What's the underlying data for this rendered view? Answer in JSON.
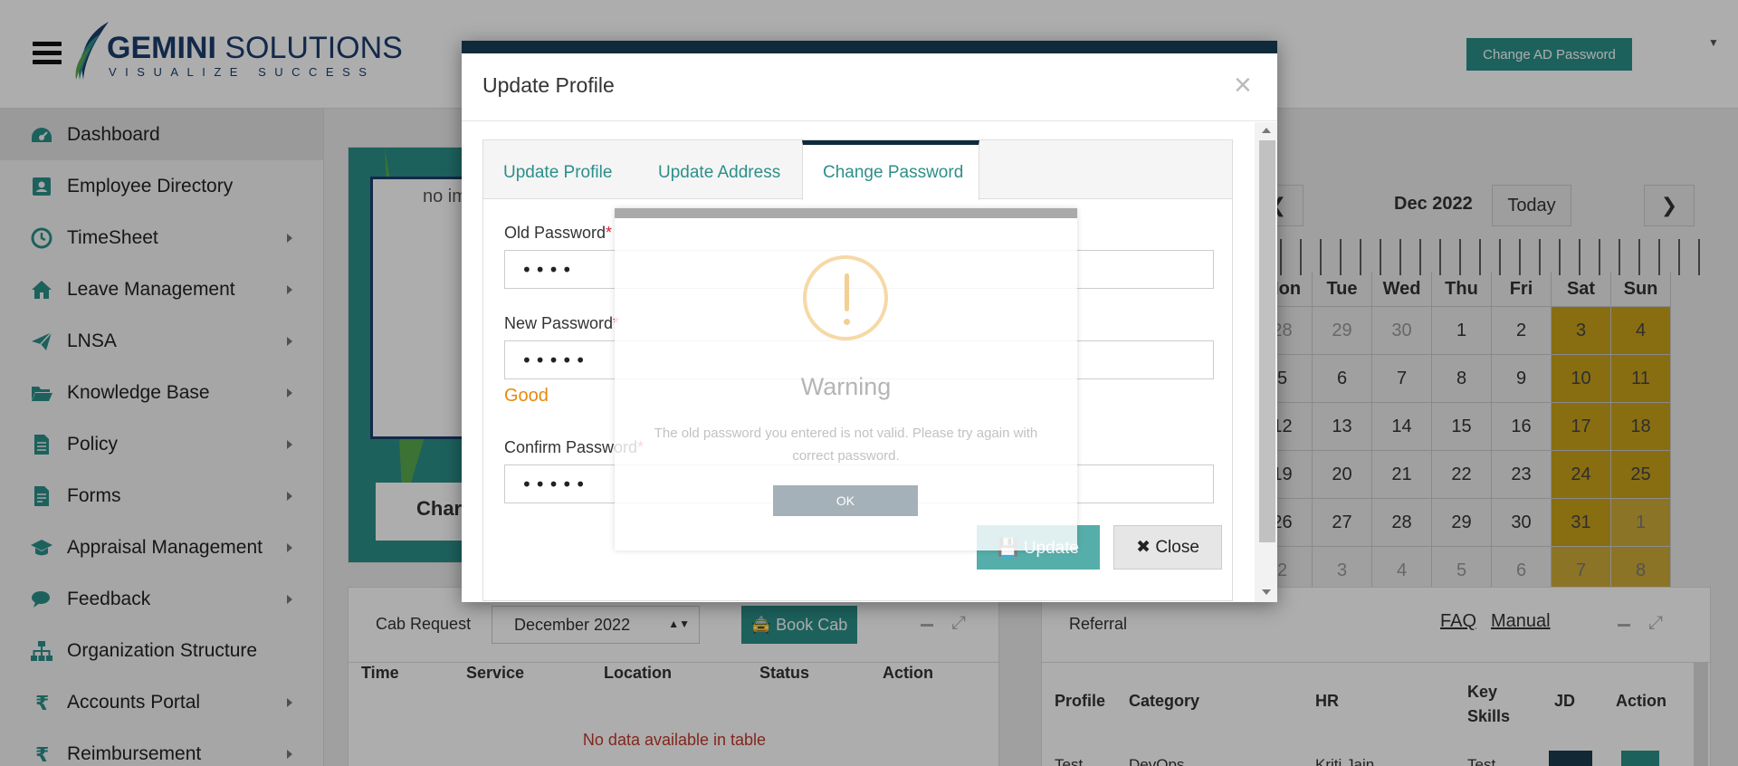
{
  "header": {
    "brand_name_bold": "GEMINI",
    "brand_name_rest": " SOLUTIONS",
    "tagline": "VISUALIZE SUCCESS",
    "ad_button": "Change AD Password"
  },
  "sidebar": {
    "items": [
      {
        "label": "Dashboard",
        "icon": "dashboard-icon"
      },
      {
        "label": "Employee Directory",
        "icon": "contact-card-icon"
      },
      {
        "label": "TimeSheet",
        "icon": "clock-icon"
      },
      {
        "label": "Leave Management",
        "icon": "home-icon"
      },
      {
        "label": "LNSA",
        "icon": "paper-plane-icon"
      },
      {
        "label": "Knowledge Base",
        "icon": "folder-open-icon"
      },
      {
        "label": "Policy",
        "icon": "document-icon"
      },
      {
        "label": "Forms",
        "icon": "form-icon"
      },
      {
        "label": "Appraisal Management",
        "icon": "graduation-cap-icon"
      },
      {
        "label": "Feedback",
        "icon": "chat-icon"
      },
      {
        "label": "Organization Structure",
        "icon": "sitemap-icon"
      },
      {
        "label": "Accounts Portal",
        "icon": "rupee-icon"
      },
      {
        "label": "Reimbursement",
        "icon": "rupee-icon"
      }
    ]
  },
  "profile": {
    "photo_alt": "no im",
    "name_partial": "Char"
  },
  "calendar": {
    "prev": "❮",
    "next": "❯",
    "month": "Dec 2022",
    "today": "Today",
    "dow": [
      "Mon",
      "Tue",
      "Wed",
      "Thu",
      "Fri",
      "Sat",
      "Sun"
    ],
    "weeks": [
      [
        "28",
        "29",
        "30",
        "1",
        "2",
        "3",
        "4"
      ],
      [
        "5",
        "6",
        "7",
        "8",
        "9",
        "10",
        "11"
      ],
      [
        "12",
        "13",
        "14",
        "15",
        "16",
        "17",
        "18"
      ],
      [
        "19",
        "20",
        "21",
        "22",
        "23",
        "24",
        "25"
      ],
      [
        "26",
        "27",
        "28",
        "29",
        "30",
        "31",
        "1"
      ],
      [
        "2",
        "3",
        "4",
        "5",
        "6",
        "7",
        "8"
      ]
    ]
  },
  "cab": {
    "title": "Cab Request",
    "month": "December 2022",
    "book": "Book Cab",
    "columns": [
      "Time",
      "Service",
      "Location",
      "Status",
      "Action"
    ],
    "empty": "No data available in table"
  },
  "referral": {
    "title": "Referral",
    "faq": "FAQ",
    "manual": "Manual",
    "columns": [
      "Profile",
      "Category",
      "HR",
      "Key Skills",
      "JD",
      "Action"
    ],
    "row": [
      "Test",
      "DevOps",
      "Kriti Jain",
      "Test"
    ]
  },
  "modal": {
    "title": "Update Profile",
    "close": "×",
    "tabs": [
      "Update Profile",
      "Update Address",
      "Change Password"
    ],
    "active_tab": "Change Password",
    "old_label": "Old Password",
    "old_value": "••••",
    "new_label": "New Password",
    "new_value": "•••••",
    "strength": "Good",
    "confirm_label": "Confirm Password",
    "confirm_value": "•••••",
    "required_mark": "*",
    "update_btn": "Update",
    "close_btn": "Close"
  },
  "warning": {
    "title": "Warning",
    "text": "The old password you entered is not valid. Please try again with correct password.",
    "ok": "OK"
  },
  "colors": {
    "teal": "#2b8f8a",
    "navy": "#0f2a3a",
    "weekend": "#c9a21a",
    "strength_good": "#e58a0e"
  }
}
